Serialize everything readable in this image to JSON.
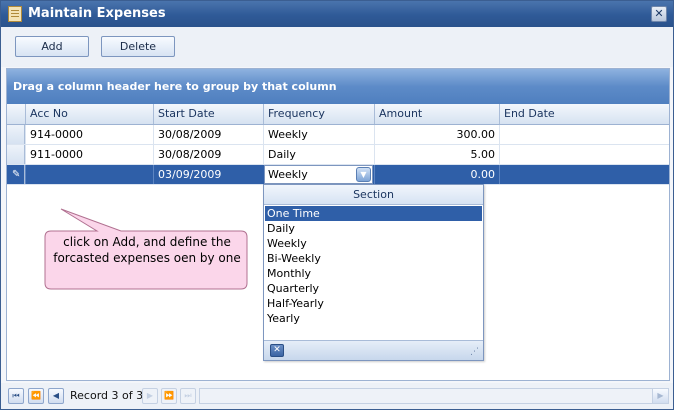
{
  "window": {
    "title": "Maintain Expenses",
    "close_glyph": "✕"
  },
  "toolbar": {
    "add_label": "Add",
    "delete_label": "Delete"
  },
  "grid": {
    "group_panel_text": "Drag a column header here to group by that column",
    "columns": [
      "Acc No",
      "Start Date",
      "Frequency",
      "Amount",
      "End Date"
    ],
    "rows": [
      {
        "acc_no": "914-0000",
        "start_date": "30/08/2009",
        "frequency": "Weekly",
        "amount": "300.00",
        "end_date": ""
      },
      {
        "acc_no": "911-0000",
        "start_date": "30/08/2009",
        "frequency": "Daily",
        "amount": "5.00",
        "end_date": ""
      },
      {
        "acc_no": "",
        "start_date": "03/09/2009",
        "frequency": "Weekly",
        "amount": "0.00",
        "end_date": ""
      }
    ],
    "selected_row": 3
  },
  "dropdown": {
    "header": "Section",
    "options": [
      "One Time",
      "Daily",
      "Weekly",
      "Bi-Weekly",
      "Monthly",
      "Quarterly",
      "Half-Yearly",
      "Yearly"
    ],
    "highlighted": "One Time"
  },
  "callout": {
    "line1": "click on Add, and define the",
    "line2": "forcasted expenses oen by one"
  },
  "navigator": {
    "record_text": "Record 3 of 3"
  },
  "colors": {
    "title_bar": "#2f5a97",
    "selection": "#2f5fa8",
    "callout_fill": "#fbd6ea",
    "callout_border": "#b07090"
  }
}
